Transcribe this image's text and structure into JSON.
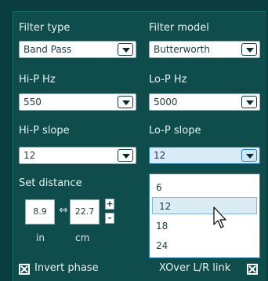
{
  "filter_type": {
    "label": "Filter type",
    "value": "Band Pass"
  },
  "filter_model": {
    "label": "Filter model",
    "value": "Butterworth"
  },
  "hip_hz": {
    "label": "Hi-P Hz",
    "value": "550"
  },
  "lop_hz": {
    "label": "Lo-P Hz",
    "value": "5000"
  },
  "hip_slope": {
    "label": "Hi-P slope",
    "value": "12"
  },
  "lop_slope": {
    "label": "Lo-P slope",
    "value": "12",
    "options": [
      "6",
      "12",
      "18",
      "24"
    ],
    "highlighted": "12"
  },
  "distance": {
    "label": "Set distance",
    "in_value": "8.9",
    "cm_value": "22.7",
    "in_unit": "in",
    "cm_unit": "cm",
    "plus": "+",
    "minus": "-"
  },
  "invert_phase": {
    "label": "Invert phase",
    "checked": true
  },
  "xover_link": {
    "label": "XOver L/R link",
    "checked": true
  }
}
